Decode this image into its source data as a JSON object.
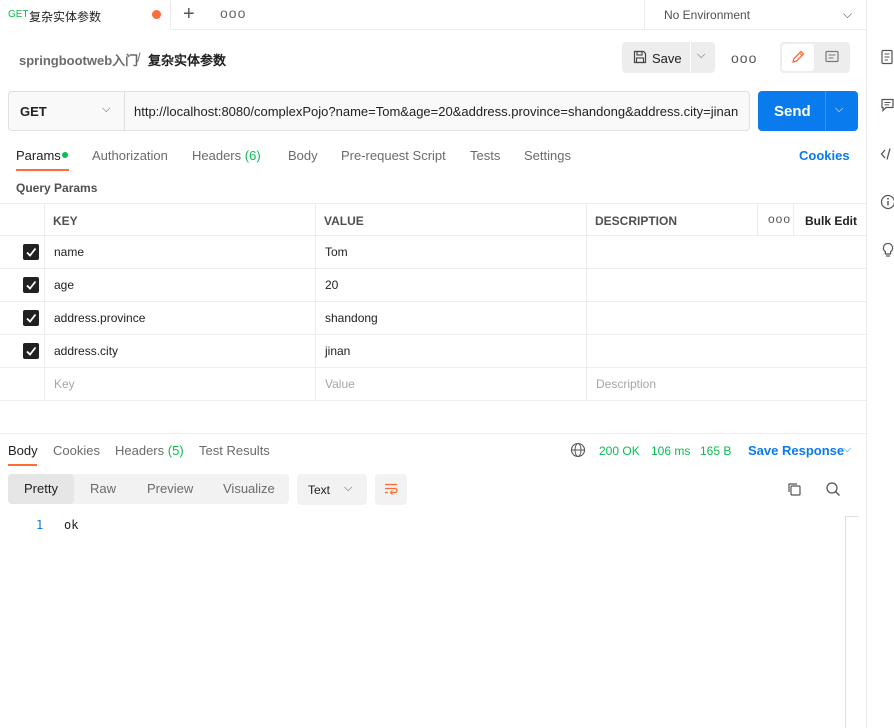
{
  "tabbar": {
    "active_tab": {
      "method": "GET",
      "title": "复杂实体参数"
    },
    "new_tab_glyph": "+",
    "more_glyph": "ooo",
    "environment": "No Environment"
  },
  "breadcrumb": {
    "parent": "springbootweb入门",
    "separator": "/",
    "current": "复杂实体参数"
  },
  "toolbar": {
    "save_label": "Save",
    "more_glyph": "ooo"
  },
  "request": {
    "method": "GET",
    "url": "http://localhost:8080/complexPojo?name=Tom&age=20&address.province=shandong&address.city=jinan",
    "send_label": "Send"
  },
  "request_tabs": {
    "params": "Params",
    "authorization": "Authorization",
    "headers": "Headers",
    "headers_count": "(6)",
    "body": "Body",
    "prerequest": "Pre-request Script",
    "tests": "Tests",
    "settings": "Settings",
    "cookies": "Cookies"
  },
  "query_params": {
    "title": "Query Params",
    "headers": {
      "key": "KEY",
      "value": "VALUE",
      "description": "DESCRIPTION",
      "more": "ooo",
      "bulk_edit": "Bulk Edit"
    },
    "rows": [
      {
        "key": "name",
        "value": "Tom",
        "description": "",
        "checked": true
      },
      {
        "key": "age",
        "value": "20",
        "description": "",
        "checked": true
      },
      {
        "key": "address.province",
        "value": "shandong",
        "description": "",
        "checked": true
      },
      {
        "key": "address.city",
        "value": "jinan",
        "description": "",
        "checked": true
      }
    ],
    "placeholder": {
      "key": "Key",
      "value": "Value",
      "description": "Description"
    }
  },
  "response_tabs": {
    "body": "Body",
    "cookies": "Cookies",
    "headers": "Headers",
    "headers_count": "(5)",
    "test_results": "Test Results"
  },
  "response_status": {
    "code": "200 OK",
    "time": "106 ms",
    "size": "165 B",
    "save_response": "Save Response"
  },
  "format_tabs": {
    "pretty": "Pretty",
    "raw": "Raw",
    "preview": "Preview",
    "visualize": "Visualize",
    "text_select": "Text"
  },
  "response_body": {
    "lines": [
      {
        "number": "1",
        "content": "ok"
      }
    ]
  },
  "colors": {
    "accent": "#ff6c37",
    "primary": "#097bed",
    "success": "#0cbb52"
  }
}
